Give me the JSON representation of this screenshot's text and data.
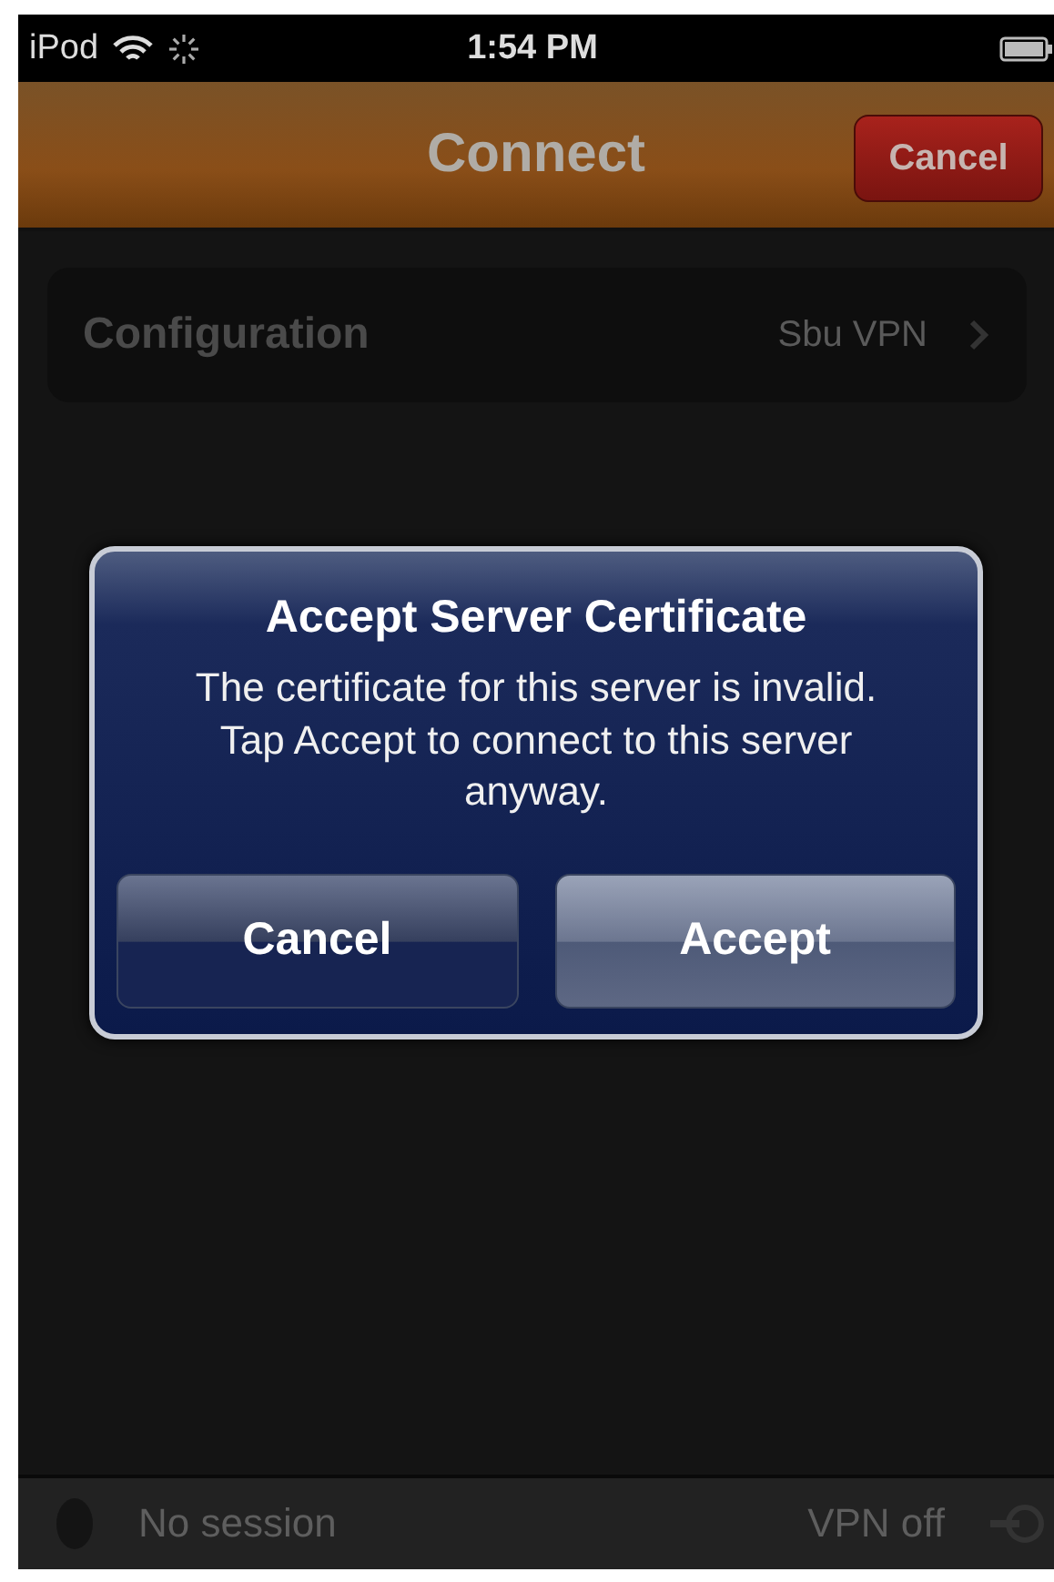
{
  "status_bar": {
    "carrier": "iPod",
    "time": "1:54 PM"
  },
  "nav_bar": {
    "title": "Connect",
    "button": "Cancel"
  },
  "configuration": {
    "label": "Configuration",
    "value": "Sbu VPN"
  },
  "alert": {
    "title": "Accept Server Certificate",
    "message": "The certificate for this server is invalid. Tap Accept to connect to this server anyway.",
    "buttons": [
      {
        "label": "Cancel",
        "kind": "cancel"
      },
      {
        "label": "Accept",
        "kind": "default"
      }
    ]
  },
  "bottom_bar": {
    "session": "No session",
    "vpn": "VPN off"
  }
}
